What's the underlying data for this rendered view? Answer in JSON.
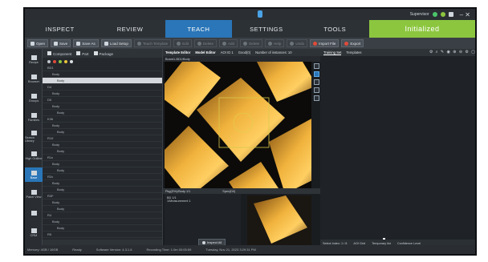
{
  "titlebar": {
    "user": "Supervisor",
    "window_controls": "– ✕"
  },
  "tabs": [
    {
      "label": "INSPECT",
      "w": 88
    },
    {
      "label": "REVIEW",
      "w": 88
    },
    {
      "label": "TEACH",
      "w": 84
    },
    {
      "label": "SETTINGS",
      "w": 86
    },
    {
      "label": "TOOLS",
      "w": 86
    }
  ],
  "status_label": "Initialized",
  "toolbar": {
    "items": [
      {
        "label": "Open",
        "state": "on"
      },
      {
        "label": "Save",
        "state": "on"
      },
      {
        "label": "Save As",
        "state": "on"
      },
      {
        "label": "Load Setup",
        "state": "on"
      },
      {
        "label": "Teach Template",
        "state": "dim"
      },
      {
        "label": "Edit",
        "state": "dim"
      },
      {
        "label": "Delete",
        "state": "dim"
      },
      {
        "label": "Add",
        "state": "dim"
      },
      {
        "label": "Delete",
        "state": "dim"
      },
      {
        "label": "Help",
        "state": "dim"
      },
      {
        "label": "Undo",
        "state": "dim"
      },
      {
        "label": "Import File",
        "state": "red"
      },
      {
        "label": "Export",
        "state": "red"
      }
    ]
  },
  "rail": [
    {
      "label": "Recipe",
      "active": false
    },
    {
      "label": "Browser",
      "active": false
    },
    {
      "label": "Groups",
      "active": false
    },
    {
      "label": "Families",
      "active": false
    },
    {
      "label": "Search Library",
      "active": false
    },
    {
      "label": "High Outline",
      "active": false
    },
    {
      "label": "Base",
      "active": true
    },
    {
      "label": "Panel View",
      "active": false
    },
    {
      "label": "",
      "active": false
    },
    {
      "label": "CRM",
      "active": false
    }
  ],
  "tree": {
    "header": [
      "Component",
      "Part",
      "Package"
    ],
    "rows": [
      {
        "label": "BD1",
        "indent": 0,
        "selected": false
      },
      {
        "label": "Body",
        "indent": 6,
        "selected": false
      },
      {
        "label": "Body",
        "indent": 12,
        "selected": true
      },
      {
        "label": "D4",
        "indent": 0,
        "selected": false
      },
      {
        "label": "Body",
        "indent": 6,
        "selected": false
      },
      {
        "label": "D5",
        "indent": 0,
        "selected": false
      },
      {
        "label": "Body",
        "indent": 6,
        "selected": false
      },
      {
        "label": "Body",
        "indent": 12,
        "selected": false
      },
      {
        "label": "K36",
        "indent": 0,
        "selected": false
      },
      {
        "label": "Body",
        "indent": 6,
        "selected": false
      },
      {
        "label": "Body",
        "indent": 12,
        "selected": false
      },
      {
        "label": "R19",
        "indent": 0,
        "selected": false
      },
      {
        "label": "Body",
        "indent": 6,
        "selected": false
      },
      {
        "label": "Body",
        "indent": 12,
        "selected": false
      },
      {
        "label": "R1x",
        "indent": 0,
        "selected": false
      },
      {
        "label": "Body",
        "indent": 6,
        "selected": false
      },
      {
        "label": "Body",
        "indent": 12,
        "selected": false
      },
      {
        "label": "R2x",
        "indent": 0,
        "selected": false
      },
      {
        "label": "Body",
        "indent": 6,
        "selected": false
      },
      {
        "label": "Body",
        "indent": 12,
        "selected": false
      },
      {
        "label": "R3F",
        "indent": 0,
        "selected": false
      },
      {
        "label": "Body",
        "indent": 6,
        "selected": false
      },
      {
        "label": "Body",
        "indent": 12,
        "selected": false
      },
      {
        "label": "R4",
        "indent": 0,
        "selected": false
      },
      {
        "label": "Body",
        "indent": 6,
        "selected": false
      },
      {
        "label": "Body",
        "indent": 12,
        "selected": false
      },
      {
        "label": "R5",
        "indent": 0,
        "selected": false
      }
    ]
  },
  "viewer": {
    "tabs": [
      "Template Editor",
      "Model Editor",
      "AOI ID 1",
      "Good(0)",
      "Number of instances: 10"
    ],
    "path": "Board1-BD1/Body",
    "thumb_bar": [
      "Pkg(D%)/Body 1/1",
      "Spec(D0)"
    ],
    "thumb_text": [
      "BD 1/1",
      "1/Measurement 1"
    ],
    "inspect_label": "Inspect All"
  },
  "right": {
    "tabs": [
      "Training Set",
      "Templates"
    ],
    "footer": [
      "Select Index: 1 / 8",
      "AOI Grid",
      "Temporary list",
      "Confidence Level"
    ]
  },
  "statusbar": [
    "Memory: 4GB / 16GB",
    "Ready",
    "Software Version: 4.3.1.6",
    "Recording Time: 1.0m 00:05:59",
    "Tuesday, Nov 21, 2023   3:29:31 PM"
  ]
}
